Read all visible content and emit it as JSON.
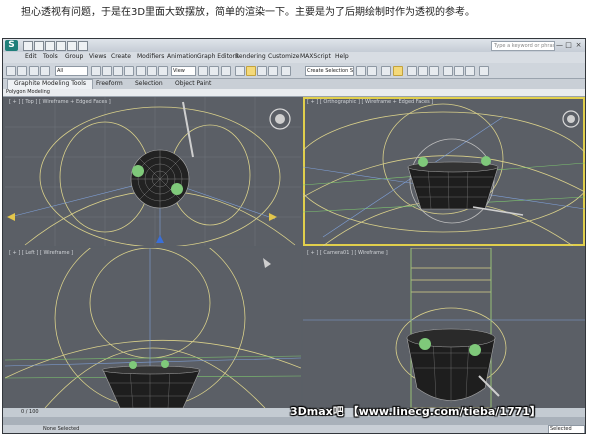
{
  "caption": "担心透视有问题，于是在3D里面大致摆放，简单的渲染一下。主要是为了后期绘制时作为透视的参考。",
  "app": {
    "logo_text": "S",
    "title": "",
    "search_placeholder": "Type a keyword or phrase",
    "window_controls": [
      "—",
      "□",
      "×"
    ]
  },
  "menu": [
    "Edit",
    "Tools",
    "Group",
    "Views",
    "Create",
    "Modifiers",
    "Animation",
    "Graph Editors",
    "Rendering",
    "Customize",
    "MAXScript",
    "Help"
  ],
  "toolbar": {
    "filter_value": "All",
    "view_value": "View",
    "selection_set": "Create Selection Set"
  },
  "ribbon": {
    "tabs": [
      "Graphite Modeling Tools",
      "Freeform",
      "Selection",
      "Object Paint"
    ],
    "subtab": "Polygon Modeling"
  },
  "viewports": [
    {
      "label": "[ + ] [ Top ] [ Wireframe + Edged Faces ]"
    },
    {
      "label": "[ + ] [ Orthographic ] [ Wireframe + Edged Faces ]"
    },
    {
      "label": "[ + ] [ Left ] [ Wireframe ]"
    },
    {
      "label": "[ + ] [ Camera01 ] [ Wireframe ]"
    }
  ],
  "timeslider": {
    "value": "0 / 100"
  },
  "status": {
    "text": "None Selected",
    "selection": "Selected"
  },
  "colors": {
    "viewport_bg": "#5b5f66",
    "active_border": "#e1cf4c",
    "wire_yellow": "#d9d08a"
  },
  "watermark": "3Dmax吧 【www.linecg.com/tieba/1771】"
}
